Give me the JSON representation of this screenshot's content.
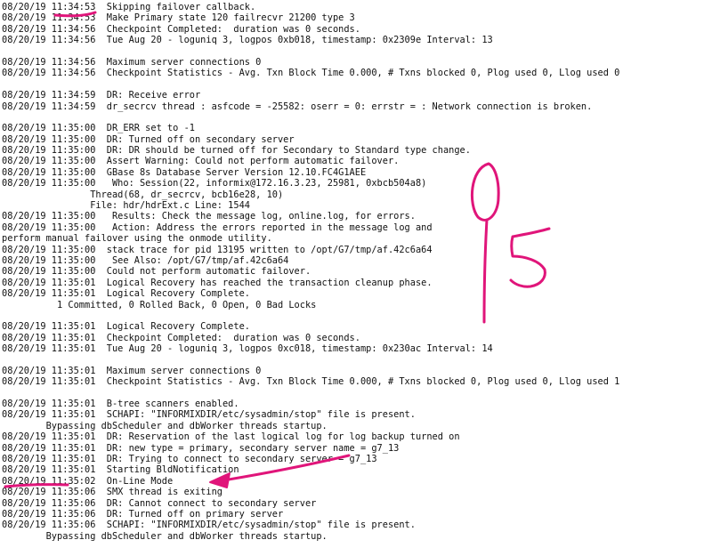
{
  "log_lines": [
    "08/20/19 11:34:53  Skipping failover callback.",
    "08/20/19 11:34:53  Make Primary state 120 failrecvr 21200 type 3",
    "08/20/19 11:34:56  Checkpoint Completed:  duration was 0 seconds.",
    "08/20/19 11:34:56  Tue Aug 20 - loguniq 3, logpos 0xb018, timestamp: 0x2309e Interval: 13",
    "",
    "08/20/19 11:34:56  Maximum server connections 0",
    "08/20/19 11:34:56  Checkpoint Statistics - Avg. Txn Block Time 0.000, # Txns blocked 0, Plog used 0, Llog used 0",
    "",
    "08/20/19 11:34:59  DR: Receive error",
    "08/20/19 11:34:59  dr_secrcv thread : asfcode = -25582: oserr = 0: errstr = : Network connection is broken.",
    "",
    "08/20/19 11:35:00  DR_ERR set to -1",
    "08/20/19 11:35:00  DR: Turned off on secondary server",
    "08/20/19 11:35:00  DR: DR should be turned off for Secondary to Standard type change.",
    "08/20/19 11:35:00  Assert Warning: Could not perform automatic failover.",
    "08/20/19 11:35:00  GBase 8s Database Server Version 12.10.FC4G1AEE",
    "08/20/19 11:35:00   Who: Session(22, informix@172.16.3.23, 25981, 0xbcb504a8)",
    "                Thread(68, dr_secrcv, bcb16e28, 10)",
    "                File: hdr/hdrExt.c Line: 1544",
    "08/20/19 11:35:00   Results: Check the message log, online.log, for errors.",
    "08/20/19 11:35:00   Action: Address the errors reported in the message log and",
    "perform manual failover using the onmode utility.",
    "08/20/19 11:35:00  stack trace for pid 13195 written to /opt/G7/tmp/af.42c6a64",
    "08/20/19 11:35:00   See Also: /opt/G7/tmp/af.42c6a64",
    "08/20/19 11:35:00  Could not perform automatic failover.",
    "08/20/19 11:35:01  Logical Recovery has reached the transaction cleanup phase.",
    "08/20/19 11:35:01  Logical Recovery Complete.",
    "          1 Committed, 0 Rolled Back, 0 Open, 0 Bad Locks",
    "",
    "08/20/19 11:35:01  Logical Recovery Complete.",
    "08/20/19 11:35:01  Checkpoint Completed:  duration was 0 seconds.",
    "08/20/19 11:35:01  Tue Aug 20 - loguniq 3, logpos 0xc018, timestamp: 0x230ac Interval: 14",
    "",
    "08/20/19 11:35:01  Maximum server connections 0",
    "08/20/19 11:35:01  Checkpoint Statistics - Avg. Txn Block Time 0.000, # Txns blocked 0, Plog used 0, Llog used 1",
    "",
    "08/20/19 11:35:01  B-tree scanners enabled.",
    "08/20/19 11:35:01  SCHAPI: \"INFORMIXDIR/etc/sysadmin/stop\" file is present.",
    "        Bypassing dbScheduler and dbWorker threads startup.",
    "08/20/19 11:35:01  DR: Reservation of the last logical log for log backup turned on",
    "08/20/19 11:35:01  DR: new type = primary, secondary server name = g7_13",
    "08/20/19 11:35:01  DR: Trying to connect to secondary server = g7_13",
    "08/20/19 11:35:01  Starting BldNotification",
    "08/20/19 11:35:02  On-Line Mode",
    "08/20/19 11:35:06  SMX thread is exiting",
    "08/20/19 11:35:06  DR: Cannot connect to secondary server",
    "08/20/19 11:35:06  DR: Turned off on primary server",
    "08/20/19 11:35:06  SCHAPI: \"INFORMIXDIR/etc/sysadmin/stop\" file is present.",
    "        Bypassing dbScheduler and dbWorker threads startup."
  ],
  "annotation": {
    "handwritten_text": "9s",
    "color": "#e0157a"
  }
}
